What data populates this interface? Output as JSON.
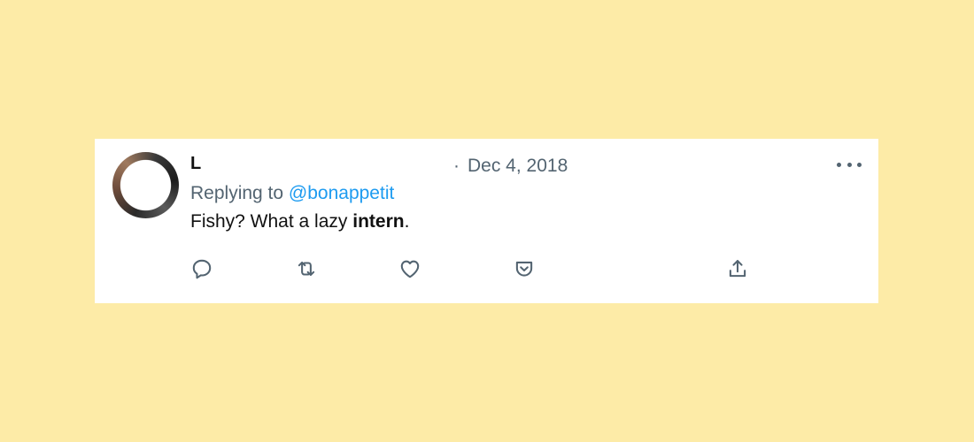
{
  "tweet": {
    "author_name": "L",
    "date_separator": "·",
    "date": "Dec 4, 2018",
    "replying_prefix": "Replying to ",
    "replying_handle": "@bonappetit",
    "text_before": "Fishy? What a lazy ",
    "text_bold": "intern",
    "text_after": "."
  },
  "icons": {
    "more": "more-horizontal-icon",
    "reply": "reply-icon",
    "retweet": "retweet-icon",
    "like": "heart-icon",
    "save": "pocket-save-icon",
    "share": "share-icon"
  },
  "colors": {
    "background": "#fdeba7",
    "card": "#ffffff",
    "text": "#111111",
    "muted": "#536471",
    "link": "#1d9bf0"
  }
}
